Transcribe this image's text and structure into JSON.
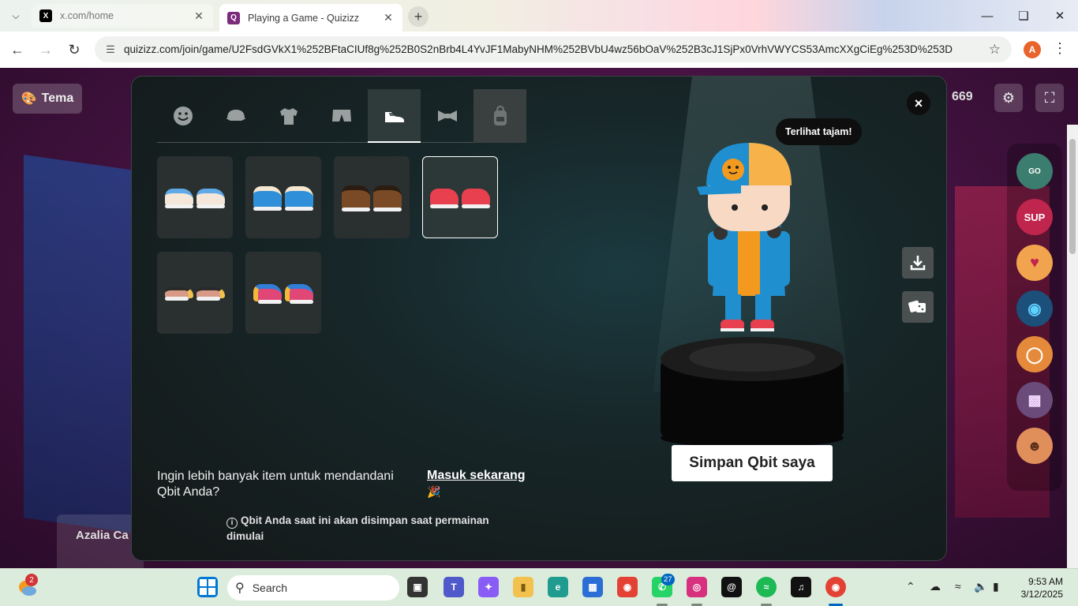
{
  "browser": {
    "tabs": [
      {
        "title": "x.com/home",
        "favicon": "x-logo-icon",
        "active": false
      },
      {
        "title": "Playing a Game - Quizizz",
        "favicon": "quizizz-logo-icon",
        "active": true
      }
    ],
    "url": "quizizz.com/join/game/U2FsdGVkX1%252BFtaCIUf8g%252B0S2nBrb4L4YvJF1MabyNHM%252BVbU4wz56bOaV%252B3cJ1SjPx0VrhVWYCS53AmcXXgCiEg%253D%253D",
    "profile_initial": "A"
  },
  "page": {
    "theme_button": "Tema",
    "score": "669",
    "bottom_player_name": "Azalia Ca",
    "stickers": [
      "LET'S GO",
      "SUP",
      "heart-hand",
      "eye",
      "donut",
      "pixel-alien",
      "cat"
    ]
  },
  "modal": {
    "categories": [
      {
        "icon": "face-icon",
        "state": "normal"
      },
      {
        "icon": "cap-icon",
        "state": "normal"
      },
      {
        "icon": "shirt-icon",
        "state": "normal"
      },
      {
        "icon": "pants-icon",
        "state": "normal"
      },
      {
        "icon": "shoe-icon",
        "state": "active"
      },
      {
        "icon": "bowtie-icon",
        "state": "normal"
      },
      {
        "icon": "backpack-icon",
        "state": "locked"
      }
    ],
    "items": [
      {
        "name": "white-slippers",
        "colors": [
          "#f4e6d8",
          "#5ea9e6"
        ],
        "selected": false
      },
      {
        "name": "blue-fur-boots",
        "colors": [
          "#2f8fd8",
          "#f6e7d0"
        ],
        "selected": false
      },
      {
        "name": "brown-boots",
        "colors": [
          "#7a4a27",
          "#2b1c12"
        ],
        "selected": false
      },
      {
        "name": "red-sneakers",
        "colors": [
          "#e8404e",
          "#ffffff"
        ],
        "selected": true
      },
      {
        "name": "black-sandals",
        "colors": [
          "#2a2a2a",
          "#f2c14e"
        ],
        "selected": false
      },
      {
        "name": "colorful-sneakers",
        "colors": [
          "#e04676",
          "#f2b83a"
        ],
        "selected": false
      }
    ],
    "more_items_text": "Ingin lebih banyak item untuk mendandani Qbit Anda?",
    "login_link": "Masuk sekarang",
    "note": "Qbit Anda saat ini akan disimpan saat permainan dimulai",
    "speech_bubble": "Terlihat tajam!",
    "save_button": "Simpan Qbit saya",
    "close_label": "×"
  },
  "taskbar": {
    "weather_badge": "2",
    "search_placeholder": "Search",
    "whatsapp_count": "27",
    "time": "9:53 AM",
    "date": "3/12/2025"
  }
}
